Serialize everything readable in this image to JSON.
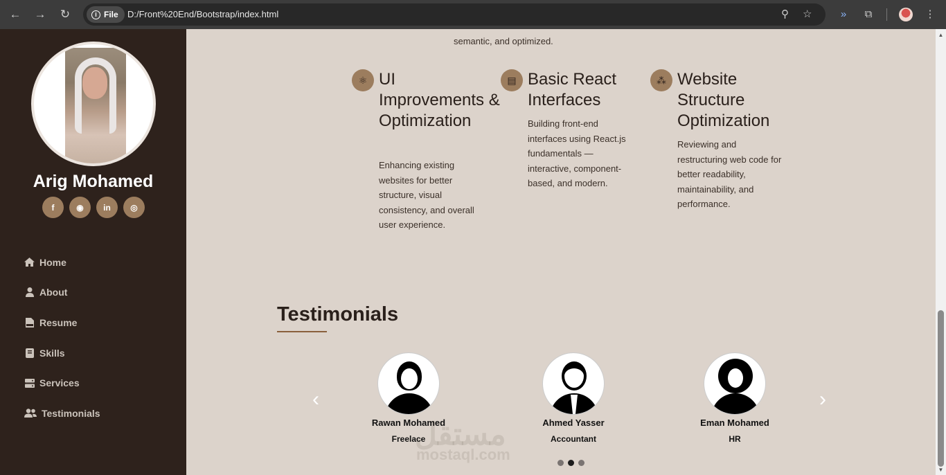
{
  "browser": {
    "site_label": "File",
    "url": "D:/Front%20End/Bootstrap/index.html",
    "icons": [
      "back-icon",
      "forward-icon",
      "reload-icon",
      "zoom-icon",
      "star-icon",
      "read-aloud-icon",
      "extensions-icon",
      "profile-avatar",
      "menu-icon"
    ]
  },
  "sidebar": {
    "name": "Arig Mohamed",
    "social": [
      {
        "icon": "facebook-icon",
        "glyph": "f"
      },
      {
        "icon": "github-icon",
        "glyph": "◉"
      },
      {
        "icon": "linkedin-icon",
        "glyph": "in"
      },
      {
        "icon": "instagram-icon",
        "glyph": "◎"
      }
    ],
    "nav": [
      {
        "label": "Home",
        "icon": "home-icon"
      },
      {
        "label": "About",
        "icon": "user-icon"
      },
      {
        "label": "Resume",
        "icon": "pdf-file-icon"
      },
      {
        "label": "Skills",
        "icon": "book-icon"
      },
      {
        "label": "Services",
        "icon": "server-icon"
      },
      {
        "label": "Testimonials",
        "icon": "users-icon"
      }
    ]
  },
  "main": {
    "cut_text": "semantic, and optimized.",
    "services": [
      {
        "icon": "react-icon",
        "title": "UI Improvements & Optimization",
        "desc": "Enhancing existing websites for better structure, visual consistency, and overall user experience."
      },
      {
        "icon": "folder-tree-icon",
        "title": "Basic React Interfaces",
        "desc": "Building front-end interfaces using React.js fundamentals — interactive, component-based, and modern."
      },
      {
        "icon": "sitemap-icon",
        "title": "Website Structure Optimization",
        "desc": "Reviewing and restructuring web code for better readability, maintainability, and performance."
      }
    ],
    "testimonials_title": "Testimonials",
    "testimonials": [
      {
        "name": "Rawan Mohamed",
        "role": "Freelace"
      },
      {
        "name": "Ahmed Yasser",
        "role": "Accountant"
      },
      {
        "name": "Eman Mohamed",
        "role": "HR"
      }
    ],
    "carousel_active_dot": 2,
    "watermark": "مستقل",
    "watermark_sub": "mostaql.com"
  },
  "colors": {
    "sidebar_bg": "#2e221c",
    "main_bg": "#dcd3cb",
    "accent": "#9c7d5e"
  }
}
